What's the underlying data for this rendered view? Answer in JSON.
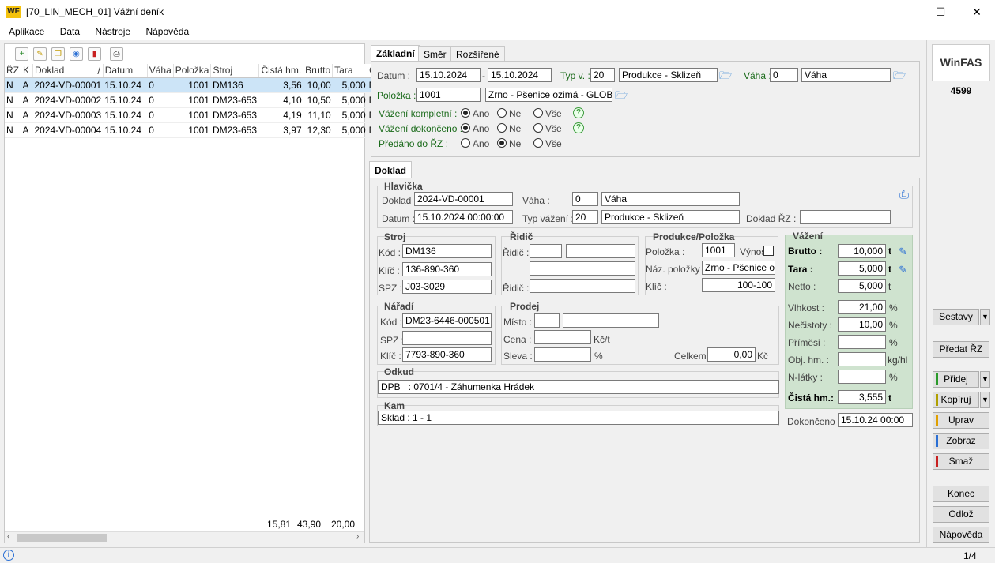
{
  "window": {
    "title": "[70_LIN_MECH_01] Vážní deník",
    "logo": "WF",
    "minimize": "—",
    "maximize": "☐",
    "close": "✕"
  },
  "menu": [
    "Aplikace",
    "Data",
    "Nástroje",
    "Nápověda"
  ],
  "grid": {
    "columns": [
      "ŘZ",
      "K",
      "Doklad",
      "/",
      "Datum",
      "Váha",
      "Položka",
      "Stroj",
      "Čistá hm.",
      "Brutto",
      "Tara",
      "Oc"
    ],
    "rows": [
      [
        "N",
        "A",
        "2024-VD-00001",
        "15.10.24",
        "0",
        "1001",
        "DM136",
        "3,56",
        "10,00",
        "5,000",
        "D"
      ],
      [
        "N",
        "A",
        "2024-VD-00002",
        "15.10.24",
        "0",
        "1001",
        "DM23-653",
        "4,10",
        "10,50",
        "5,000",
        "D"
      ],
      [
        "N",
        "A",
        "2024-VD-00003",
        "15.10.24",
        "0",
        "1001",
        "DM23-653",
        "4,19",
        "11,10",
        "5,000",
        "D"
      ],
      [
        "N",
        "A",
        "2024-VD-00004",
        "15.10.24",
        "0",
        "1001",
        "DM23-653",
        "3,97",
        "12,30",
        "5,000",
        "D"
      ]
    ],
    "totals": {
      "cista": "15,81",
      "brutto": "43,90",
      "tara": "20,00"
    }
  },
  "filter": {
    "tabs": [
      "Základní",
      "Směr",
      "Rozšířené"
    ],
    "datum_label": "Datum :",
    "datum_from": "15.10.2024",
    "dash": "-",
    "datum_to": "15.10.2024",
    "typ_label": "Typ v. :",
    "typ_code": "20",
    "typ_name": "Produkce - Sklizeň",
    "vaha_label": "Váha :",
    "vaha_code": "0",
    "vaha_name": "Váha",
    "polozka_label": "Položka :",
    "polozka_code": "1001",
    "polozka_name": "Zrno - Pšenice ozimá - GLOBU",
    "r1_label": "Vážení kompletní :",
    "r2_label": "Vážení dokončeno :",
    "r3_label": "Předáno do ŘZ :",
    "ano": "Ano",
    "ne": "Ne",
    "vse": "Vše",
    "help": "?"
  },
  "doklad": {
    "tab": "Doklad",
    "hlavicka": "Hlavička",
    "doklad_label": "Doklad :",
    "doklad": "2024-VD-00001",
    "vaha_label": "Váha :",
    "vaha_code": "0",
    "vaha_name": "Váha",
    "datum_label": "Datum :",
    "datum": "15.10.2024 00:00:00",
    "typ_label": "Typ vážení :",
    "typ_code": "20",
    "typ_name": "Produkce - Sklizeň",
    "dokladrz_label": "Doklad ŘZ :",
    "dokladrz": ""
  },
  "stroj": {
    "title": "Stroj",
    "kod_label": "Kód :",
    "kod": "DM136",
    "klic_label": "Klíč :",
    "klic": "136-890-360",
    "spz_label": "SPZ :",
    "spz": "J03-3029"
  },
  "ridic": {
    "title": "Řidič",
    "ridic1_label": "Řidič :",
    "ridic2_label": "Řidič :"
  },
  "produkce": {
    "title": "Produkce/Položka",
    "polozka_label": "Položka :",
    "polozka": "1001",
    "vynos_label": "Výnos",
    "naz_label": "Náz. položky :",
    "naz": "Zrno - Pšenice oz",
    "klic_label": "Klíč :",
    "klic": "100-100"
  },
  "naradi": {
    "title": "Nářadí",
    "kod_label": "Kód :",
    "kod": "DM23-6446-000501",
    "spz_label": "SPZ :",
    "spz": "",
    "klic_label": "Klíč :",
    "klic": "7793-890-360"
  },
  "prodej": {
    "title": "Prodej",
    "misto_label": "Místo :",
    "cena_label": "Cena :",
    "cena_unit": "Kč/t",
    "sleva_label": "Sleva :",
    "sleva_unit": "%",
    "celkem_label": "Celkem :",
    "celkem": "0,00",
    "celkem_unit": "Kč"
  },
  "odkud": {
    "title": "Odkud",
    "value": "DPB   : 0701/4 - Záhumenka Hrádek"
  },
  "kam": {
    "title": "Kam",
    "value": "Sklad : 1 - 1"
  },
  "vazeni": {
    "title": "Vážení",
    "brutto_label": "Brutto :",
    "brutto": "10,000",
    "t": "t",
    "tara_label": "Tara :",
    "tara": "5,000",
    "netto_label": "Netto :",
    "netto": "5,000",
    "vlhkost_label": "Vlhkost :",
    "vlhkost": "21,00",
    "pct": "%",
    "necistoty_label": "Nečistoty :",
    "necistoty": "10,00",
    "primesi_label": "Příměsi :",
    "primesi": "",
    "objhm_label": "Obj. hm. :",
    "objhm": "",
    "kghl": "kg/hl",
    "nlatky_label": "N-látky :",
    "nlatky": "",
    "cista_label": "Čistá hm.:",
    "cista": "3,555",
    "dokonceno_label": "Dokončeno :",
    "dokonceno": "15.10.24 00:00"
  },
  "side": {
    "brand": "WinFAS",
    "number": "4599",
    "sestavy": "Sestavy",
    "predat": "Předat ŘZ",
    "pridej": "Přidej",
    "kopiruj": "Kopíruj",
    "uprav": "Uprav",
    "zobraz": "Zobraz",
    "smaz": "Smaž",
    "konec": "Konec",
    "odloz": "Odlož",
    "napoveda": "Nápověda"
  },
  "status": {
    "page": "1/4",
    "info": "i"
  }
}
